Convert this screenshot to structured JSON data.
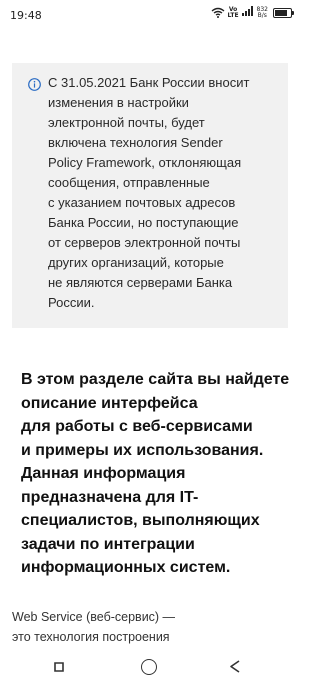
{
  "status_bar": {
    "time": "19:48",
    "network": [
      "Vo",
      "LTE"
    ],
    "speed": [
      "832",
      "B/s"
    ],
    "battery_level": 0.8
  },
  "notice": {
    "icon": "info-icon",
    "lines": [
      "С 31.05.2021 Банк России вносит",
      "изменения в настройки",
      "электронной почты, будет",
      "включена технология Sender",
      "Policy Framework, отклоняющая",
      "сообщения, отправленные",
      "с указанием почтовых адресов",
      "Банка России, но поступающие",
      "от серверов электронной почты",
      "других организаций, которые",
      "не являются серверами Банка",
      "России."
    ]
  },
  "intro": {
    "lines": [
      "В этом разделе сайта вы найдете",
      "описание интерфейса",
      "для работы с веб-сервисами",
      "и примеры их использования.",
      "Данная информация",
      "предназначена для IT-",
      "специалистов, выполняющих",
      "задачи по интеграции",
      "информационных систем."
    ]
  },
  "body": {
    "lines": [
      "Web Service (веб-сервис) —",
      "это технология построения"
    ]
  },
  "nav_bar": {
    "icons": [
      "recent-apps-icon",
      "home-icon",
      "back-icon"
    ]
  }
}
